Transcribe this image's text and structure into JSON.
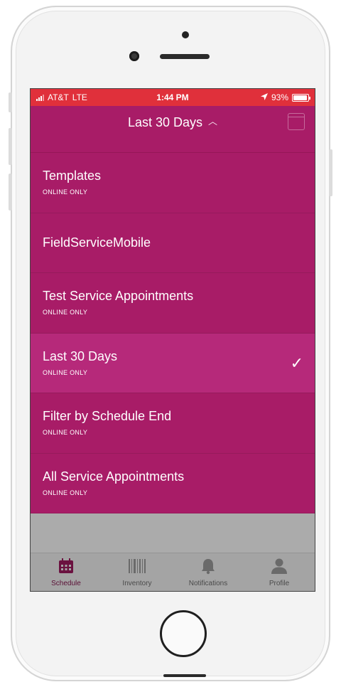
{
  "status_bar": {
    "carrier": "AT&T",
    "network": "LTE",
    "time": "1:44 PM",
    "battery": "93%",
    "battery_level": 0.93
  },
  "header": {
    "title": "Last 30 Days",
    "title_chevron": "chevron-up-icon",
    "calendar_icon": "calendar-icon"
  },
  "list_items": [
    {
      "label": "Templates",
      "sub": "ONLINE ONLY",
      "selected": false
    },
    {
      "label": "FieldServiceMobile",
      "sub": "",
      "selected": false
    },
    {
      "label": "Test Service Appointments",
      "sub": "ONLINE ONLY",
      "selected": false
    },
    {
      "label": "Last 30 Days",
      "sub": "ONLINE ONLY",
      "selected": true
    },
    {
      "label": "Filter by Schedule End",
      "sub": "ONLINE ONLY",
      "selected": false
    },
    {
      "label": "All Service Appointments",
      "sub": "ONLINE ONLY",
      "selected": false
    }
  ],
  "tabs": [
    {
      "label": "Schedule",
      "icon": "calendar-icon",
      "active": true
    },
    {
      "label": "Inventory",
      "icon": "barcode-icon",
      "active": false
    },
    {
      "label": "Notifications",
      "icon": "bell-icon",
      "active": false
    },
    {
      "label": "Profile",
      "icon": "person-icon",
      "active": false
    }
  ],
  "colors": {
    "status_bar": "#e0303b",
    "menu_background": "#a81c67",
    "selected_item": "#b6297a",
    "active_tab": "#5a1036",
    "overlay": "#ababab"
  }
}
